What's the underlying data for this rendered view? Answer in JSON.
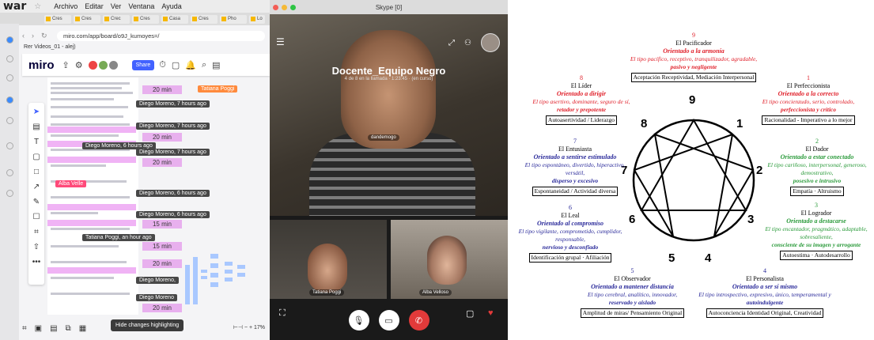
{
  "mac": {
    "app_name": "war",
    "menu": [
      "Archivo",
      "Editar",
      "Ver",
      "Ventana",
      "Ayuda"
    ]
  },
  "browser": {
    "tabs": [
      "Cres",
      "Cres",
      "Crec",
      "Cres",
      "Casa",
      "Cres",
      "Pho",
      "Lo"
    ],
    "url": "miro.com/app/board/o9J_kumoyes=/",
    "bookmark": "Rer Videos_01 - alej)"
  },
  "miro": {
    "logo": "miro",
    "share_label": "Share",
    "badges": [
      "Diego Moreno, 7 hours ago",
      "Diego Moreno, 7 hours ago",
      "Diego Moreno, 6 hours ago",
      "Diego Moreno, 7 hours ago",
      "Diego Moreno, 6 hours ago",
      "Diego Moreno, 6 hours ago",
      "Tatiana Poggi, an hour ago",
      "Diego Moreno,",
      "Diego Moreno"
    ],
    "minutes": [
      "20 min",
      "20 min",
      "20 min",
      "15 min",
      "15 min",
      "20 min",
      "20 min"
    ],
    "user_tags": [
      "Tatiana Poggi",
      "Alba Velle"
    ],
    "hint": "Hide changes highlighting",
    "zoom": "17%"
  },
  "skype": {
    "window_title": "Skype [0]",
    "call_title": "Docente_Equipo Negro",
    "call_subtitle": "4 de 8 en la llamada · 1:23:45 · (en curso)",
    "main_name": "dandemogo",
    "participants": [
      "Tatiana Poggi",
      "Alba Velloso"
    ]
  },
  "enneagram": {
    "numbers": [
      "9",
      "1",
      "2",
      "3",
      "4",
      "5",
      "6",
      "7",
      "8"
    ],
    "types": {
      "t9": {
        "num": "9",
        "name": "El Pacificador",
        "orient": "Orientado a la armonía",
        "desc": "El tipo pacífico, receptivo, tranquilizador, agradable,",
        "key": "pasivo y negligente",
        "box": "Aceptación Receptividad, Mediación Interpersonal"
      },
      "t8": {
        "num": "8",
        "name": "El Líder",
        "orient": "Orientado a dirigir",
        "desc": "El tipo asertivo, dominante, seguro de sí,",
        "key": "retador y prepotente",
        "box": "Autoasertividad / Liderazgo"
      },
      "t1": {
        "num": "1",
        "name": "El Perfeccionista",
        "orient": "Orientado a la correcto",
        "desc": "El tipo concienzudo, serio, controlado,",
        "key": "perfeccionista y crítico",
        "box": "Racionalidad - Imperativo a lo mejor"
      },
      "t7": {
        "num": "7",
        "name": "El Entusiasta",
        "orient": "Orientado a sentirse estimulado",
        "desc": "El tipo espontáneo, divertido, hiperactivo, versátil,",
        "key": "disperso y excesivo",
        "box": "Espontaneidad / Actividad diversa"
      },
      "t2": {
        "num": "2",
        "name": "El Dador",
        "orient": "Orientado a estar conectado",
        "desc": "El tipo cariñoso, interpersonal, generoso, demostrativo,",
        "key": "posesivo e intrusivo",
        "box": "Empatía · Altruismo"
      },
      "t6": {
        "num": "6",
        "name": "El Leal",
        "orient": "Orientado al compromiso",
        "desc": "El tipo vigilante, comprometido, cumplidor, responsable,",
        "key": "nervioso y desconfiado",
        "box": "Identificación grupal · Afiliación"
      },
      "t3": {
        "num": "3",
        "name": "El Logrador",
        "orient": "Orientado a destacarse",
        "desc": "El tipo encantador, pragmático, adaptable, sobresaliente,",
        "key": "consciente de su imagen y arrogante",
        "box": "Autoestima · Autodesarrollo"
      },
      "t5": {
        "num": "5",
        "name": "El Observador",
        "orient": "Orientado a mantener distancia",
        "desc": "El tipo cerebral, analítico, innovador,",
        "key": "reservado y aislado",
        "box": "Amplitud de miras/ Pensamiento Original"
      },
      "t4": {
        "num": "4",
        "name": "El Personalista",
        "orient": "Orientado a ser sí mismo",
        "desc": "El tipo introspectivo, expresivo, único, temperamental y",
        "key": "autoindulgente",
        "box": "Autoconciencia Identidad Original, Creatividad"
      }
    }
  }
}
